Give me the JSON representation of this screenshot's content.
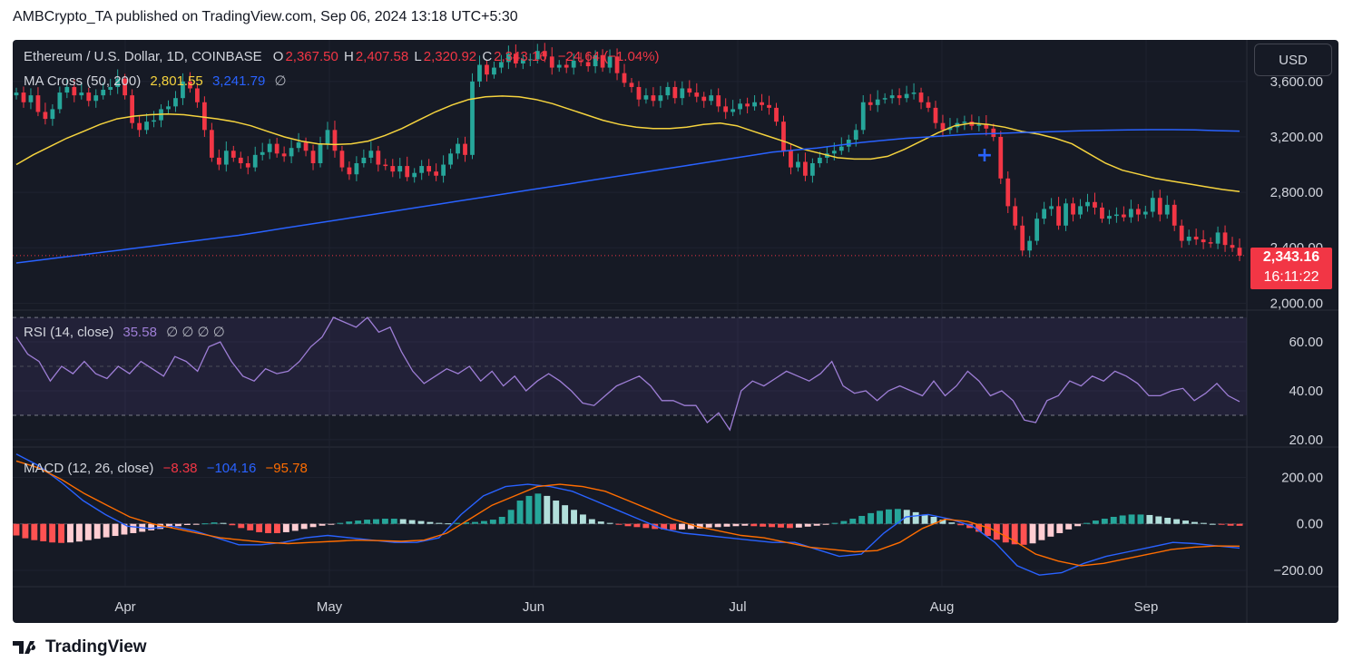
{
  "publisher": {
    "text": "AMBCrypto_TA published on TradingView.com, Sep 06, 2024 13:18 UTC+5:30"
  },
  "footer": {
    "brand": "TradingView"
  },
  "currency_button": "USD",
  "legend": {
    "symbol": "Ethereum / U.S. Dollar, 1D, COINBASE",
    "open_label": "O",
    "open": "2,367.50",
    "high_label": "H",
    "high": "2,407.58",
    "low_label": "L",
    "low": "2,320.92",
    "close_label": "C",
    "close": "2,343.16",
    "change": "−24.64 (−1.04%)",
    "ma_label": "MA Cross (50, 200)",
    "ma50": "2,801.55",
    "ma200": "3,241.79",
    "ma_extra": "∅",
    "rsi_label": "RSI (14, close)",
    "rsi_value": "35.58",
    "rsi_extra": "∅ ∅ ∅ ∅",
    "macd_label": "MACD (12, 26, close)",
    "macd_hist": "−8.38",
    "macd_line": "−104.16",
    "macd_signal": "−95.78"
  },
  "price_tag": {
    "price": "2,343.16",
    "countdown": "16:11:22"
  },
  "colors": {
    "up": "#26a69a",
    "down": "#f23645",
    "ma50": "#f5d33e",
    "ma200": "#2962ff",
    "rsi": "#9e7ed6",
    "macd": "#2962ff",
    "signal": "#ff6d00"
  },
  "chart_data": [
    {
      "type": "candlestick",
      "title": "Ethereum / U.S. Dollar, 1D, COINBASE",
      "x_tick_labels": [
        "Apr",
        "May",
        "Jun",
        "Jul",
        "Aug",
        "Sep"
      ],
      "y_tick_labels": [
        "3,600.00",
        "3,200.00",
        "2,800.00",
        "2,400.00",
        "2,000.00"
      ],
      "ylim": [
        1950,
        3900
      ],
      "close_series": [
        3520,
        3450,
        3500,
        3380,
        3330,
        3400,
        3520,
        3560,
        3500,
        3520,
        3460,
        3500,
        3540,
        3560,
        3620,
        3500,
        3300,
        3250,
        3310,
        3320,
        3400,
        3420,
        3480,
        3600,
        3550,
        3450,
        3250,
        3050,
        3000,
        3100,
        3050,
        3010,
        2980,
        3070,
        3090,
        3150,
        3080,
        3060,
        3120,
        3160,
        3100,
        3010,
        3150,
        3250,
        3100,
        2980,
        2930,
        3010,
        3050,
        3100,
        3000,
        2990,
        2950,
        2990,
        2910,
        2940,
        2990,
        2950,
        2920,
        3000,
        3080,
        3150,
        3070,
        3600,
        3720,
        3650,
        3700,
        3740,
        3800,
        3730,
        3760,
        3760,
        3820,
        3780,
        3700,
        3720,
        3700,
        3750,
        3740,
        3710,
        3790,
        3700,
        3780,
        3660,
        3590,
        3560,
        3470,
        3500,
        3460,
        3500,
        3560,
        3480,
        3550,
        3520,
        3490,
        3460,
        3500,
        3420,
        3380,
        3400,
        3440,
        3420,
        3450,
        3430,
        3410,
        3310,
        3100,
        2980,
        3020,
        2920,
        3010,
        3050,
        3080,
        3100,
        3130,
        3180,
        3250,
        3450,
        3430,
        3470,
        3480,
        3500,
        3480,
        3510,
        3520,
        3450,
        3410,
        3300,
        3250,
        3270,
        3300,
        3310,
        3280,
        3290,
        3260,
        3200,
        2900,
        2700,
        2560,
        2380,
        2450,
        2610,
        2680,
        2700,
        2560,
        2720,
        2640,
        2700,
        2730,
        2690,
        2610,
        2630,
        2640,
        2620,
        2680,
        2640,
        2660,
        2760,
        2640,
        2710,
        2560,
        2450,
        2480,
        2460,
        2440,
        2430,
        2510,
        2420,
        2400,
        2343.16
      ],
      "series": [
        {
          "name": "MA 50",
          "value_label": "2,801.55",
          "values": [
            3000,
            3070,
            3130,
            3190,
            3240,
            3290,
            3330,
            3350,
            3360,
            3365,
            3360,
            3345,
            3330,
            3310,
            3280,
            3240,
            3200,
            3170,
            3150,
            3145,
            3150,
            3170,
            3210,
            3260,
            3320,
            3380,
            3430,
            3470,
            3490,
            3495,
            3490,
            3470,
            3440,
            3400,
            3360,
            3320,
            3290,
            3270,
            3260,
            3260,
            3270,
            3290,
            3300,
            3280,
            3240,
            3200,
            3160,
            3110,
            3080,
            3050,
            3040,
            3040,
            3060,
            3110,
            3170,
            3230,
            3280,
            3300,
            3290,
            3270,
            3240,
            3220,
            3190,
            3150,
            3080,
            3010,
            2960,
            2930,
            2900,
            2880,
            2860,
            2840,
            2820,
            2805
          ]
        },
        {
          "name": "MA 200",
          "value_label": "3,241.79",
          "values": [
            2290,
            2310,
            2330,
            2350,
            2370,
            2390,
            2410,
            2430,
            2450,
            2470,
            2490,
            2515,
            2540,
            2565,
            2590,
            2615,
            2640,
            2665,
            2690,
            2715,
            2740,
            2765,
            2790,
            2815,
            2840,
            2865,
            2890,
            2915,
            2940,
            2965,
            2990,
            3015,
            3040,
            3065,
            3090,
            3105,
            3120,
            3140,
            3160,
            3175,
            3190,
            3200,
            3210,
            3220,
            3225,
            3230,
            3235,
            3240,
            3245,
            3248,
            3250,
            3252,
            3252,
            3250,
            3245,
            3242
          ]
        }
      ]
    },
    {
      "type": "line",
      "title": "RSI (14, close)",
      "y_tick_labels": [
        "60.00",
        "40.00",
        "20.00"
      ],
      "ylim": [
        17,
        73
      ],
      "series": [
        {
          "name": "RSI",
          "value_label": "35.58",
          "values": [
            62,
            55,
            52,
            44,
            50,
            47,
            52,
            47,
            45,
            50,
            47,
            52,
            49,
            46,
            54,
            52,
            48,
            58,
            60,
            52,
            46,
            44,
            49,
            47,
            48,
            52,
            58,
            62,
            70,
            68,
            66,
            70,
            64,
            66,
            56,
            48,
            43,
            46,
            49,
            47,
            50,
            44,
            48,
            42,
            46,
            40,
            44,
            47,
            44,
            40,
            35,
            34,
            38,
            42,
            44,
            46,
            42,
            36,
            36,
            34,
            34,
            27,
            31,
            24,
            40,
            44,
            42,
            45,
            48,
            46,
            44,
            47,
            52,
            42,
            39,
            40,
            36,
            40,
            42,
            40,
            38,
            44,
            38,
            42,
            48,
            44,
            38,
            40,
            36,
            28,
            27,
            36,
            38,
            44,
            42,
            46,
            44,
            48,
            46,
            43,
            38,
            38,
            40,
            41,
            36,
            39,
            43,
            38,
            35.58
          ]
        }
      ]
    },
    {
      "type": "bar",
      "title": "MACD (12, 26, close)",
      "y_tick_labels": [
        "200.00",
        "0.00",
        "−200.00"
      ],
      "ylim": [
        -270,
        330
      ],
      "values_label": "−8.38",
      "histogram": [
        -50,
        -62,
        -70,
        -75,
        -80,
        -82,
        -80,
        -76,
        -70,
        -64,
        -58,
        -52,
        -46,
        -40,
        -34,
        -28,
        -22,
        -16,
        -10,
        -5,
        -2,
        2,
        6,
        4,
        -6,
        -18,
        -28,
        -36,
        -40,
        -40,
        -36,
        -30,
        -22,
        -14,
        -8,
        -2,
        4,
        10,
        14,
        18,
        20,
        22,
        22,
        20,
        16,
        12,
        8,
        4,
        2,
        4,
        6,
        8,
        12,
        18,
        30,
        60,
        100,
        120,
        130,
        120,
        100,
        80,
        60,
        40,
        20,
        10,
        4,
        -4,
        -10,
        -14,
        -18,
        -22,
        -24,
        -26,
        -24,
        -22,
        -20,
        -16,
        -14,
        -12,
        -10,
        -8,
        -10,
        -12,
        -14,
        -16,
        -18,
        -16,
        -12,
        -8,
        -4,
        4,
        12,
        22,
        34,
        46,
        56,
        62,
        64,
        60,
        50,
        40,
        30,
        18,
        6,
        -6,
        -18,
        -34,
        -52,
        -68,
        -80,
        -88,
        -90,
        -84,
        -70,
        -55,
        -40,
        -24,
        -10,
        4,
        14,
        22,
        30,
        36,
        40,
        40,
        38,
        32,
        26,
        20,
        14,
        8,
        4,
        0,
        -4,
        -8,
        -8.38
      ],
      "series": [
        {
          "name": "MACD",
          "value_label": "−104.16",
          "values": [
            300,
            250,
            180,
            100,
            40,
            -10,
            -20,
            -10,
            -30,
            -60,
            -90,
            -90,
            -80,
            -60,
            -50,
            -60,
            -70,
            -80,
            -80,
            -60,
            40,
            120,
            160,
            170,
            160,
            140,
            100,
            60,
            20,
            -20,
            -40,
            -50,
            -60,
            -70,
            -80,
            -80,
            -110,
            -140,
            -130,
            -40,
            30,
            40,
            20,
            -10,
            -80,
            -180,
            -220,
            -210,
            -170,
            -140,
            -120,
            -100,
            -80,
            -85,
            -95,
            -104.16
          ]
        },
        {
          "name": "Signal",
          "value_label": "−95.78",
          "values": [
            270,
            240,
            190,
            130,
            80,
            30,
            0,
            -20,
            -40,
            -60,
            -70,
            -80,
            -85,
            -80,
            -75,
            -70,
            -72,
            -75,
            -70,
            -40,
            20,
            80,
            120,
            160,
            170,
            160,
            140,
            100,
            60,
            20,
            -10,
            -30,
            -50,
            -60,
            -80,
            -100,
            -110,
            -120,
            -115,
            -80,
            -20,
            20,
            10,
            -20,
            -70,
            -130,
            -160,
            -180,
            -170,
            -150,
            -130,
            -110,
            -100,
            -95,
            -95.78
          ]
        }
      ]
    }
  ]
}
